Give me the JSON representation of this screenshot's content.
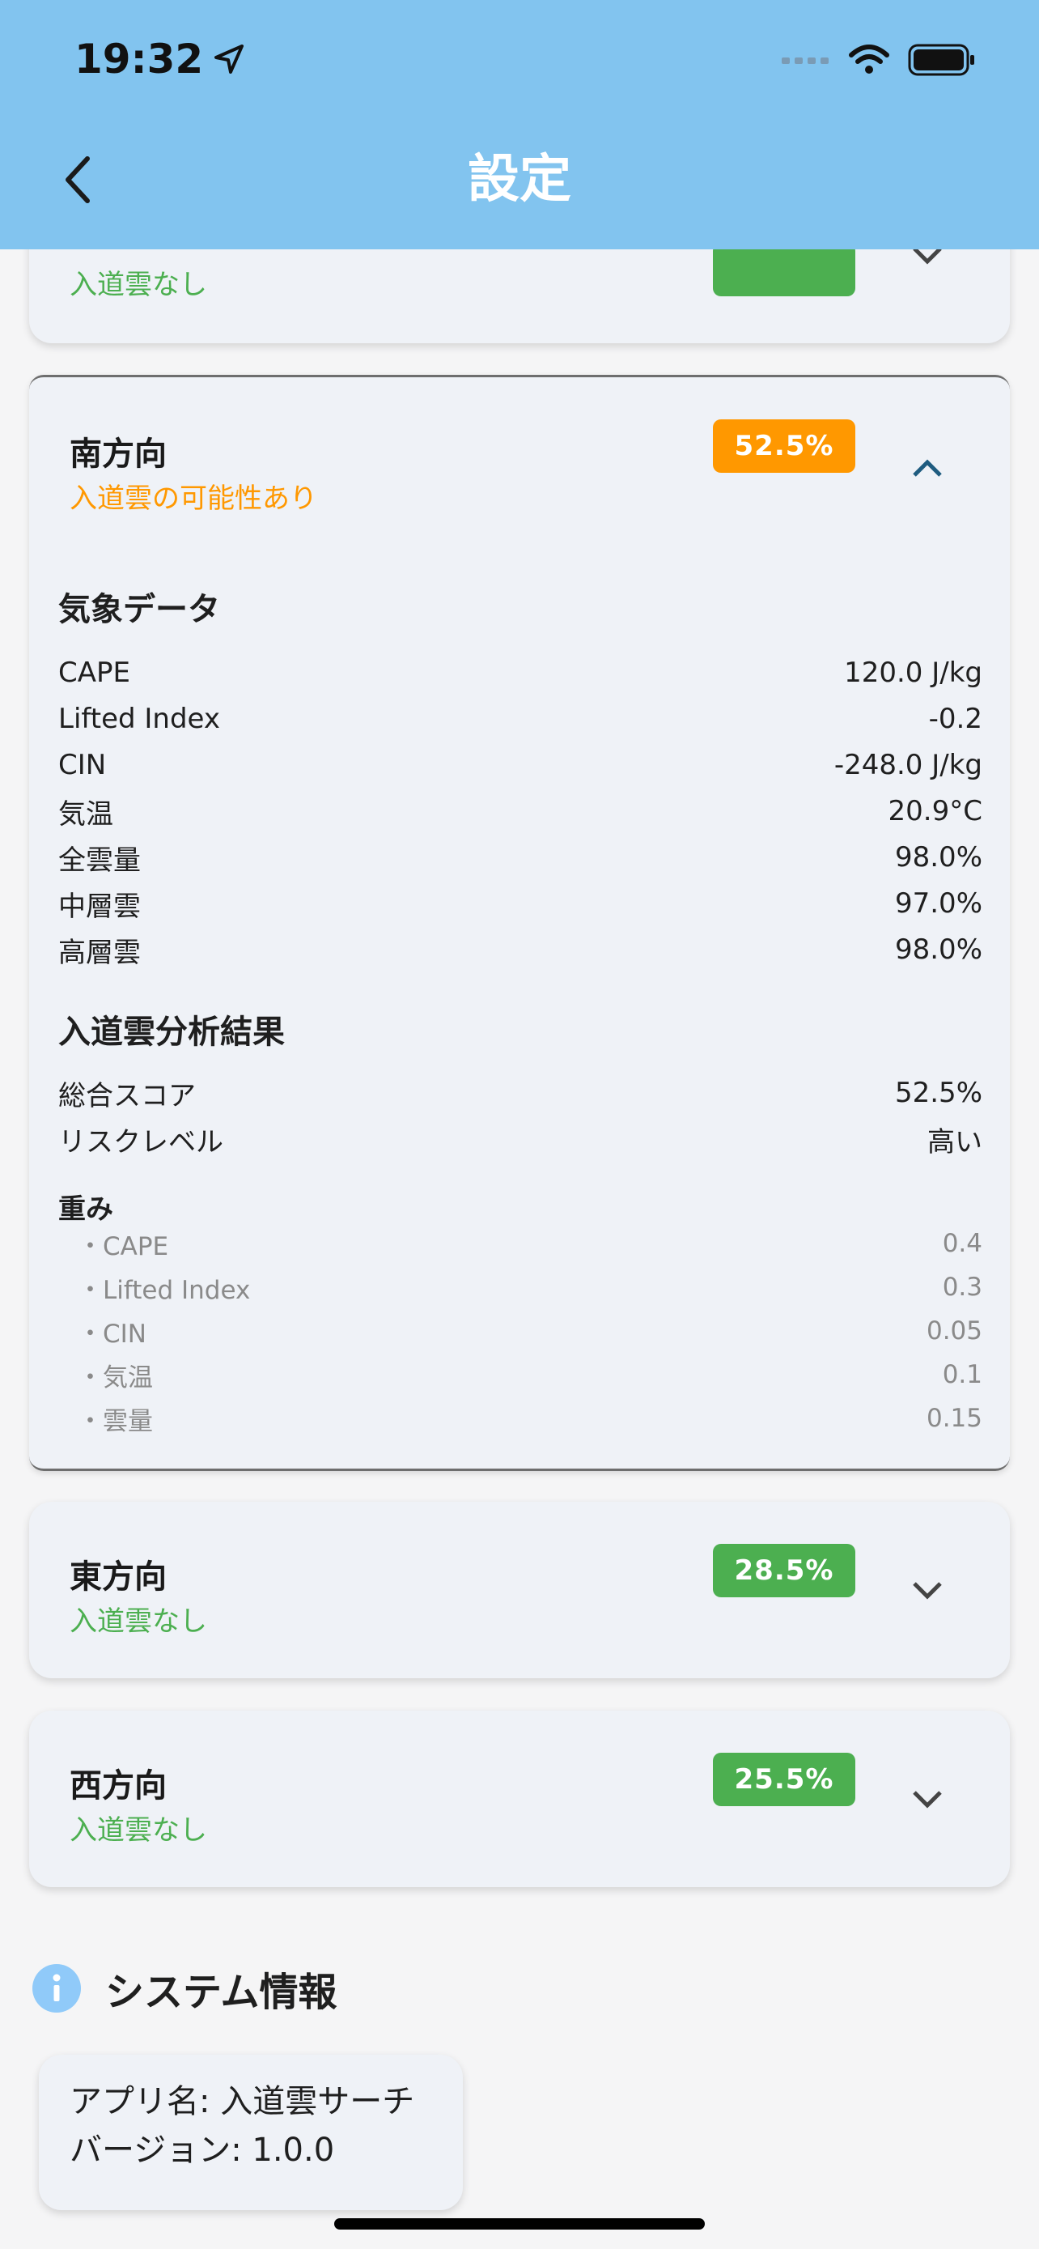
{
  "status_bar": {
    "time": "19:32"
  },
  "header": {
    "title": "設定"
  },
  "colors": {
    "header_bg": "#82c4ef",
    "green": "#4caf50",
    "orange": "#ff9800",
    "card_bg": "#eff2f7",
    "info_icon": "#90caf9"
  },
  "directions": [
    {
      "label": "",
      "status": "入道雲なし",
      "score": "",
      "expanded": false
    },
    {
      "label": "南方向",
      "status": "入道雲の可能性あり",
      "score": "52.5%",
      "expanded": true,
      "weather_title": "気象データ",
      "weather": [
        {
          "k": "CAPE",
          "v": "120.0 J/kg"
        },
        {
          "k": "Lifted Index",
          "v": "-0.2"
        },
        {
          "k": "CIN",
          "v": "-248.0 J/kg"
        },
        {
          "k": "気温",
          "v": "20.9°C"
        },
        {
          "k": "全雲量",
          "v": "98.0%"
        },
        {
          "k": "中層雲",
          "v": "97.0%"
        },
        {
          "k": "高層雲",
          "v": "98.0%"
        }
      ],
      "analysis_title": "入道雲分析結果",
      "analysis": [
        {
          "k": "総合スコア",
          "v": "52.5%"
        },
        {
          "k": "リスクレベル",
          "v": "高い"
        }
      ],
      "weights_title": "重み",
      "weights": [
        {
          "k": "・CAPE",
          "v": "0.4"
        },
        {
          "k": "・Lifted Index",
          "v": "0.3"
        },
        {
          "k": "・CIN",
          "v": "0.05"
        },
        {
          "k": "・気温",
          "v": "0.1"
        },
        {
          "k": "・雲量",
          "v": "0.15"
        }
      ]
    },
    {
      "label": "東方向",
      "status": "入道雲なし",
      "score": "28.5%",
      "expanded": false
    },
    {
      "label": "西方向",
      "status": "入道雲なし",
      "score": "25.5%",
      "expanded": false
    }
  ],
  "system": {
    "title": "システム情報",
    "icon": "info-icon",
    "app_name": "アプリ名: 入道雲サーチ",
    "version": "バージョン: 1.0.0"
  }
}
